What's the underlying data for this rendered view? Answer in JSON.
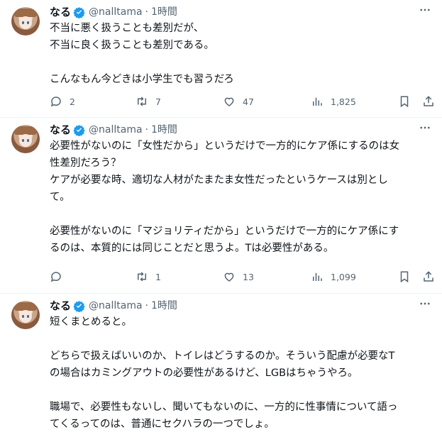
{
  "tweets": [
    {
      "name": "なる",
      "handle": "@nalltama",
      "separator": "·",
      "time": "1時間",
      "lines": [
        "不当に悪く扱うことも差別だが、",
        "不当に良く扱うことも差別である。",
        "",
        "こんなもん今どきは小学生でも習うだろ"
      ],
      "replies": "2",
      "retweets": "7",
      "likes": "47",
      "views": "1,825"
    },
    {
      "name": "なる",
      "handle": "@nalltama",
      "separator": "·",
      "time": "1時間",
      "lines": [
        "必要性がないのに「女性だから」というだけで一方的にケア係にするのは女",
        "性差別だろう？",
        "ケアが必要な時、適切な人材がたまたま女性だったというケースは別とし",
        "て。",
        "",
        "必要性がないのに「マジョリティだから」というだけで一方的にケア係にす",
        "るのは、本質的には同じことだと思うよ。Tは必要性がある。"
      ],
      "replies": "",
      "retweets": "1",
      "likes": "13",
      "views": "1,099"
    },
    {
      "name": "なる",
      "handle": "@nalltama",
      "separator": "·",
      "time": "1時間",
      "lines": [
        "短くまとめると。",
        "",
        "どちらで扱えばいいのか、トイレはどうするのか。そういう配慮が必要なT",
        "の場合はカミングアウトの必要性があるけど、LGBはちゃうやろ。",
        "",
        "職場で、必要性もないし、聞いてもないのに、一方的に性事情について語っ",
        "てくるってのは、普通にセクハラの一つでしょ。"
      ]
    }
  ],
  "colors": {
    "text": "#0f1419",
    "secondary": "#536471",
    "verified": "#1d9bf0",
    "border": "#eff3f4"
  },
  "icons": {
    "verified": "verified-badge-icon",
    "more": "more-horizontal-icon",
    "reply": "reply-bubble-icon",
    "retweet": "retweet-icon",
    "like": "heart-icon",
    "views": "bar-chart-icon",
    "bookmark": "bookmark-icon",
    "share": "share-icon"
  }
}
